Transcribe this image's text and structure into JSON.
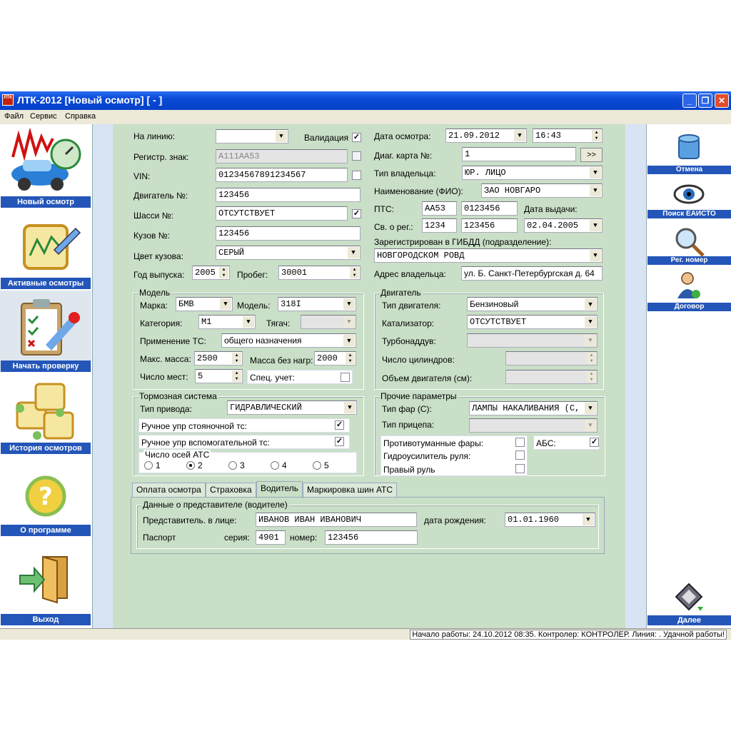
{
  "window": {
    "title": "ЛТК-2012 [Новый осмотр] [ - ]",
    "app_icon_text": "ЛТК"
  },
  "menu": [
    "Файл",
    "Сервис",
    "Справка"
  ],
  "left_nav": [
    "Новый осмотр",
    "Активные осмотры",
    "Начать проверку",
    "История осмотров",
    "О программе",
    "Выход"
  ],
  "right_nav": [
    "Отмена",
    "Поиск ЕАИСТО",
    "Рег. номер",
    "Договор",
    "Далее"
  ],
  "form": {
    "na_liniyu_label": "На линию:",
    "na_liniyu_value": "",
    "validation_label": "Валидация",
    "reg_znak_label": "Регистр. знак:",
    "reg_znak_value": "А111АА53",
    "vin_label": "VIN:",
    "vin_value": "01234567891234567",
    "engine_label": "Двигатель №:",
    "engine_value": "123456",
    "chassis_label": "Шасси №:",
    "chassis_value": "ОТСУТСТВУЕТ",
    "body_label": "Кузов №:",
    "body_value": "123456",
    "color_label": "Цвет кузова:",
    "color_value": "СЕРЫЙ",
    "year_label": "Год выпуска:",
    "year_value": "2005",
    "mileage_label": "Пробег:",
    "mileage_value": "30001",
    "date_label": "Дата осмотра:",
    "date_value": "21.09.2012",
    "time_value": "16:43",
    "diag_label": "Диаг. карта №:",
    "diag_value": "1",
    "diag_btn": ">>",
    "owner_type_label": "Тип владельца:",
    "owner_type_value": "ЮР. ЛИЦО",
    "name_label": "Наименование (ФИО):",
    "name_value": "ЗАО НОВГАРО",
    "pts_label": "ПТС:",
    "pts_series": "АА53",
    "pts_number": "0123456",
    "issue_label": "Дата выдачи:",
    "reg_cert_label": "Св. о рег.:",
    "reg_cert_series": "1234",
    "reg_cert_number": "123456",
    "issue_value": "02.04.2005",
    "gibdd_label": "Зарегистрирован в ГИБДД (подразделение):",
    "gibdd_value": "НОВГОРОДСКОМ РОВД",
    "address_label": "Адрес владельца:",
    "address_value": "ул. Б. Санкт-Петербургская д. 64"
  },
  "model_group": {
    "title": "Модель",
    "make_label": "Марка:",
    "make_value": "БМВ",
    "model_label": "Модель:",
    "model_value": "318I",
    "category_label": "Категория:",
    "category_value": "M1",
    "tyagach_label": "Тягач:",
    "use_label": "Применение ТС:",
    "use_value": "общего назначения",
    "maxmass_label": "Макс. масса:",
    "maxmass_value": "2500",
    "mass_label": "Масса без нагр:",
    "mass_value": "2000",
    "seats_label": "Число мест:",
    "seats_value": "5",
    "spec_label": "Спец. учет:"
  },
  "engine_group": {
    "title": "Двигатель",
    "type_label": "Тип двигателя:",
    "type_value": "Бензиновый",
    "cat_label": "Катализатор:",
    "cat_value": "ОТСУТСТВУЕТ",
    "turbo_label": "Турбонаддув:",
    "cyl_label": "Число цилиндров:",
    "vol_label": "Объем двигателя (см):"
  },
  "brake_group": {
    "title": "Тормозная система",
    "drive_label": "Тип привода:",
    "drive_value": "ГИДРАВЛИЧЕСКИЙ",
    "park_label": "Ручное упр стояночной тс:",
    "aux_label": "Ручное упр вспомогательной тс:",
    "axles_title": "Число осей АТС",
    "axles": [
      "1",
      "2",
      "3",
      "4",
      "5"
    ]
  },
  "other_group": {
    "title": "Прочие параметры",
    "lights_label": "Тип фар (С):",
    "lights_value": "ЛАМПЫ НАКАЛИВАНИЯ (С, (",
    "trailer_label": "Тип прицепа:",
    "fog_label": "Противотуманные фары:",
    "abs_label": "АБС:",
    "power_label": "Гидроусилитель руля:",
    "right_label": "Правый руль"
  },
  "tabs": [
    "Оплата осмотра",
    "Страховка",
    "Водитель",
    "Маркировка шин АТС"
  ],
  "rep_group": {
    "title": "Данные о представителе (водителе)",
    "person_label": "Представитель. в лице:",
    "person_value": "ИВАНОВ ИВАН ИВАНОВИЧ",
    "birth_label": "дата рождения:",
    "birth_value": "01.01.1960",
    "passport_label": "Паспорт",
    "series_label": "серия:",
    "series_value": "4901",
    "number_label": "номер:",
    "number_value": "123456"
  },
  "status": "Начало работы: 24.10.2012 08:35. Контролер: КОНТРОЛЕР. Линия: . Удачной работы!"
}
